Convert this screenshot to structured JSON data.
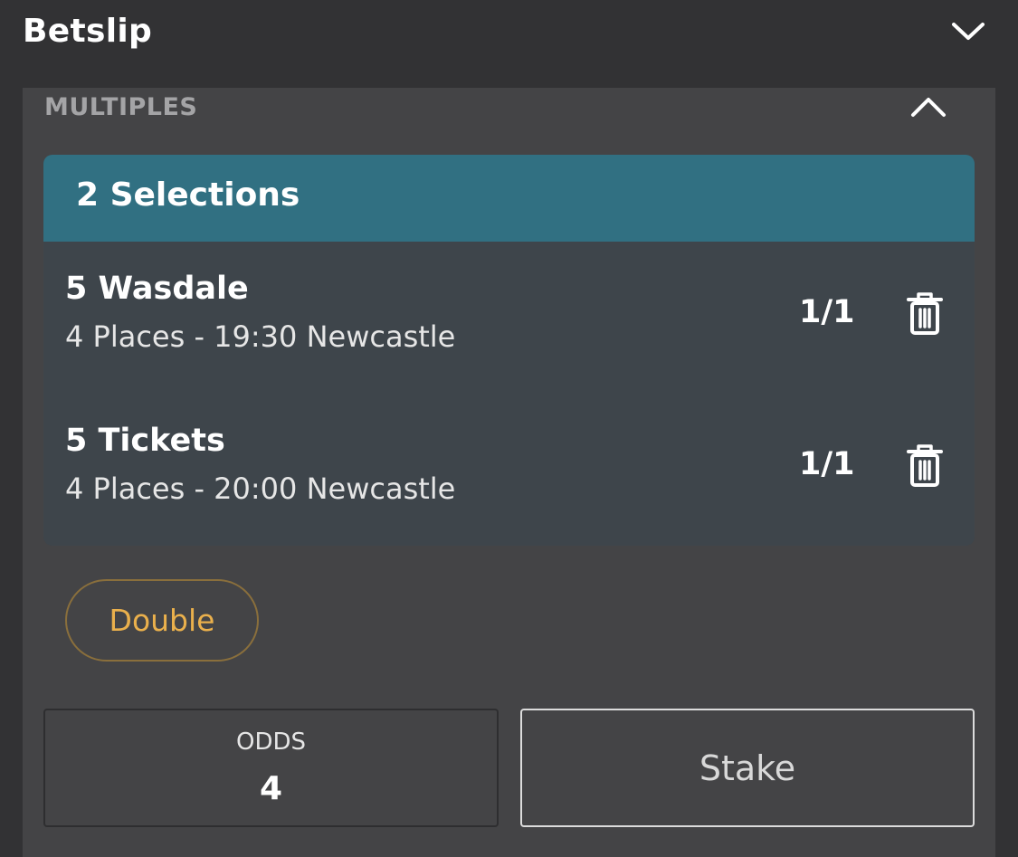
{
  "header": {
    "title": "Betslip",
    "toggle_icon": "chevron-down-icon"
  },
  "multiples": {
    "title": "MULTIPLES",
    "toggle_icon": "chevron-up-icon",
    "selections_header": "2 Selections",
    "selections": [
      {
        "name": "5 Wasdale",
        "detail": "4 Places - 19:30 Newcastle",
        "odds": "1/1",
        "remove_icon": "trash-icon"
      },
      {
        "name": "5 Tickets",
        "detail": "4 Places - 20:00 Newcastle",
        "odds": "1/1",
        "remove_icon": "trash-icon"
      }
    ],
    "bet_type": "Double",
    "odds_label": "ODDS",
    "odds_value": "4",
    "stake_placeholder": "Stake"
  },
  "colors": {
    "background": "#323234",
    "panel": "#444446",
    "selections_header": "#317082",
    "selection_row": "#3e454b",
    "bet_type_text": "#eab04c",
    "bet_type_border": "#8a6f3c"
  }
}
